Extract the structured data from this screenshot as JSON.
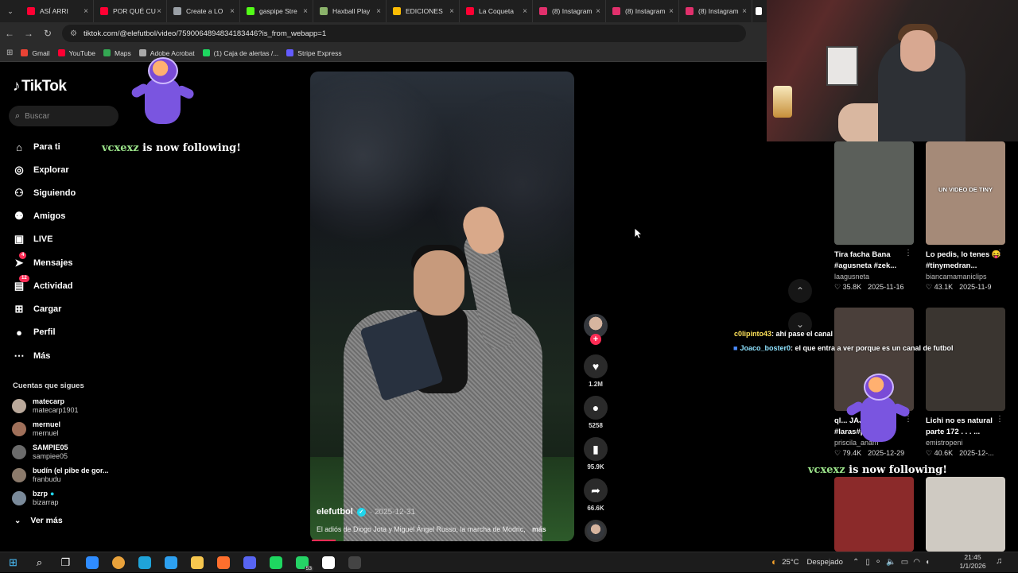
{
  "browser": {
    "tabs": [
      {
        "title": "ASÍ ARRI",
        "icon": "youtube-icon",
        "color": "#ff0033",
        "emoji": "💀"
      },
      {
        "title": "POR QUÉ CU",
        "icon": "youtube-icon",
        "color": "#ff0033"
      },
      {
        "title": "Create a LO",
        "icon": "page-icon",
        "color": "#9aa0a6"
      },
      {
        "title": "gaspipe Stre",
        "icon": "kick-icon",
        "color": "#53fc18"
      },
      {
        "title": "Haxball Play",
        "icon": "haxball-icon",
        "color": "#8bb36b"
      },
      {
        "title": "EDICIONES",
        "icon": "drive-icon",
        "color": "#fbbc04"
      },
      {
        "title": "La Coqueta",
        "icon": "youtube-icon",
        "color": "#ff0033"
      },
      {
        "title": "(8) Instagram",
        "icon": "instagram-icon",
        "color": "#e1306c"
      },
      {
        "title": "(8) Instagram",
        "icon": "instagram-icon",
        "color": "#e1306c"
      },
      {
        "title": "(8) Instagram",
        "icon": "instagram-icon",
        "color": "#e1306c"
      }
    ],
    "url": "tiktok.com/@elefutbol/video/7590064894834183446?is_from_webapp=1",
    "bookmarks": [
      {
        "label": "Gmail",
        "color": "#ea4335"
      },
      {
        "label": "YouTube",
        "color": "#ff0033"
      },
      {
        "label": "Maps",
        "color": "#34a853"
      },
      {
        "label": "Adobe Acrobat",
        "color": "#aaaaaa"
      },
      {
        "label": "(1) Caja de alertas /...",
        "color": "#1ed760"
      },
      {
        "label": "Stripe Express",
        "color": "#635bff"
      }
    ]
  },
  "tiktok": {
    "logo": "TikTok",
    "search_placeholder": "Buscar",
    "nav": [
      {
        "label": "Para ti",
        "icon": "home-icon",
        "glyph": "⌂"
      },
      {
        "label": "Explorar",
        "icon": "compass-icon",
        "glyph": "◎"
      },
      {
        "label": "Siguiendo",
        "icon": "following-icon",
        "glyph": "⚇"
      },
      {
        "label": "Amigos",
        "icon": "friends-icon",
        "glyph": "⚉"
      },
      {
        "label": "LIVE",
        "icon": "live-icon",
        "glyph": "▣"
      },
      {
        "label": "Mensajes",
        "icon": "messages-icon",
        "glyph": "➤",
        "badge": "4"
      },
      {
        "label": "Actividad",
        "icon": "activity-icon",
        "glyph": "▤",
        "badge": "12"
      },
      {
        "label": "Cargar",
        "icon": "upload-icon",
        "glyph": "⊞"
      },
      {
        "label": "Perfil",
        "icon": "profile-icon",
        "glyph": "●"
      },
      {
        "label": "Más",
        "icon": "more-icon",
        "glyph": "⋯"
      }
    ],
    "following_title": "Cuentas que sigues",
    "following": [
      {
        "name": "matecarp",
        "user": "matecarp1901",
        "color": "#b9a89a"
      },
      {
        "name": "mernuel",
        "user": "mernuel",
        "color": "#a0705a"
      },
      {
        "name": "SAMPIE05",
        "user": "sampiee05",
        "color": "#6b6b6b"
      },
      {
        "name": "budín (el pibe de gor...",
        "user": "franbudu",
        "color": "#8b7a6b"
      },
      {
        "name": "bzrp",
        "user": "bizarrap",
        "color": "#7a8a9a",
        "verified": true
      }
    ],
    "see_more": "Ver más",
    "video": {
      "username": "elefutbol",
      "date": "· 2025-12-31",
      "caption": "El adiós de Diogo Jota y Miguel Ángel Russo, la marcha de Modric,",
      "more": "más",
      "likes": "1.2M",
      "comments": "5258",
      "saves": "95.9K",
      "shares": "66.6K"
    },
    "recommended": [
      {
        "title": "Tira facha Bana #agusneta #zek...",
        "user": "laagusneta",
        "likes": "♡ 35.8K",
        "date": "2025-11-16",
        "thumb": "#5b5f5a"
      },
      {
        "title": "Lo pedis, lo tenes 😝 #tinymedran...",
        "user": "biancamamaniclips",
        "likes": "♡ 43.1K",
        "date": "2025-11-9",
        "thumb": "#a58a78",
        "overlay": "UN VIDEO DE TINY"
      },
      {
        "title": "ql... JAJaa #laras#parati#j...",
        "user": "priscila_anam",
        "likes": "♡ 79.4K",
        "date": "2025-12-29",
        "thumb": "#4a3f3a"
      },
      {
        "title": "Lichi no es natural parte 172 . . . ...",
        "user": "emistropeni",
        "likes": "♡ 40.6K",
        "date": "2025-12-...",
        "thumb": "#3a3530"
      },
      {
        "title": "",
        "user": "",
        "likes": "",
        "date": "",
        "thumb": "#8b2a2a"
      },
      {
        "title": "",
        "user": "",
        "likes": "",
        "date": "",
        "thumb": "#cfcac2"
      }
    ]
  },
  "overlays": {
    "follow_user": "vcxexz",
    "follow_text": "is now following!",
    "chat": [
      {
        "user": "c0lipinto43",
        "text": ": ahí pase el canal"
      },
      {
        "user": "Joaco_boster0",
        "text": ": el que entra a ver porque es un canal de futbol"
      }
    ]
  },
  "taskbar": {
    "items": [
      {
        "icon": "windows-icon",
        "glyph": "⊞",
        "color": "#4cc2ff"
      },
      {
        "icon": "search-icon",
        "glyph": "⌕",
        "color": "#ffffff"
      },
      {
        "icon": "task-view-icon",
        "glyph": "❐",
        "color": "#ffffff"
      },
      {
        "icon": "copilot-icon",
        "glyph": "",
        "color": "#2f8cff"
      },
      {
        "icon": "chrome-icon",
        "glyph": "",
        "color": "#e9a23b"
      },
      {
        "icon": "edge-icon",
        "glyph": "",
        "color": "#1fa3d9"
      },
      {
        "icon": "store-icon",
        "glyph": "",
        "color": "#2da0f0"
      },
      {
        "icon": "explorer-icon",
        "glyph": "",
        "color": "#f6c64e"
      },
      {
        "icon": "firefox-icon",
        "glyph": "",
        "color": "#ff6f2d"
      },
      {
        "icon": "discord-icon",
        "glyph": "",
        "color": "#5865f2"
      },
      {
        "icon": "spotify-icon",
        "glyph": "",
        "color": "#1ed760"
      },
      {
        "icon": "whatsapp-icon",
        "glyph": "",
        "color": "#25d366",
        "badge": "53"
      },
      {
        "icon": "capcut-icon",
        "glyph": "",
        "color": "#ffffff"
      },
      {
        "icon": "obs-icon",
        "glyph": "",
        "color": "#444444"
      }
    ],
    "weather_temp": "25°C",
    "weather_text": "Despejado",
    "time": "21:45",
    "date": "1/1/2026"
  }
}
